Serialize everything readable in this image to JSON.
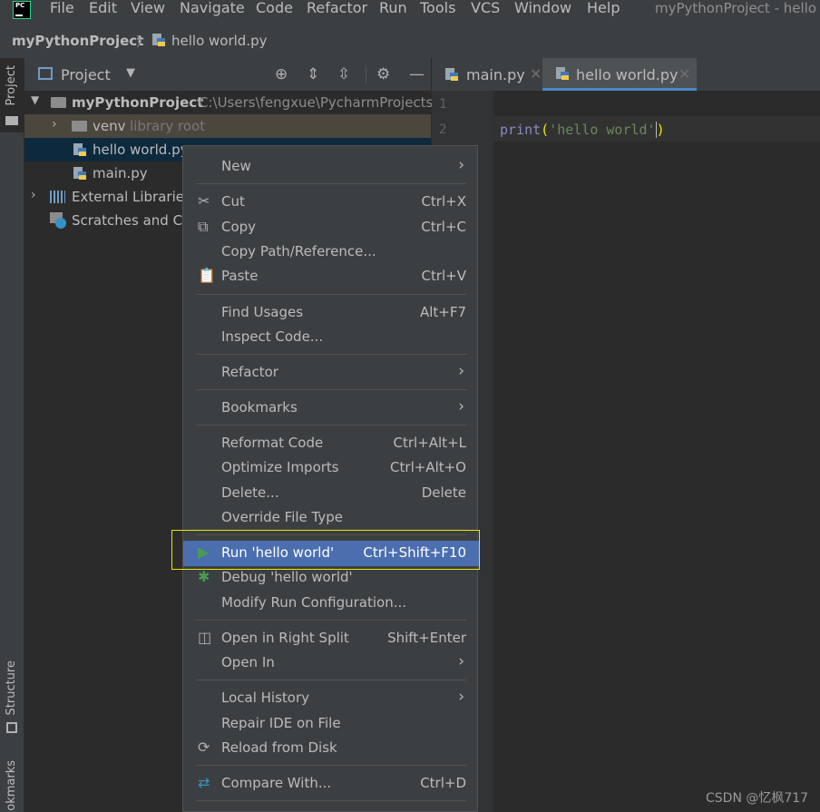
{
  "menubar": {
    "items": [
      "File",
      "Edit",
      "View",
      "Navigate",
      "Code",
      "Refactor",
      "Run",
      "Tools",
      "VCS",
      "Window",
      "Help"
    ],
    "window_title": "myPythonProject - hello w"
  },
  "navbar": {
    "project": "myPythonProject",
    "file": "hello world.py"
  },
  "left_stripe": {
    "project": "Project",
    "structure": "Structure",
    "bookmarks": "okmarks"
  },
  "project_panel": {
    "title": "Project",
    "tree": [
      {
        "label": "myPythonProject",
        "extra": "C:\\Users\\fengxue\\PycharmProjects\\"
      },
      {
        "label": "venv",
        "extra": "library root"
      },
      {
        "label": "hello world.py"
      },
      {
        "label": "main.py"
      },
      {
        "label": "External Libraries"
      },
      {
        "label": "Scratches and Co"
      }
    ]
  },
  "editor": {
    "tabs": [
      {
        "label": "main.py"
      },
      {
        "label": "hello world.py"
      }
    ],
    "line_numbers": [
      "1",
      "2"
    ],
    "code": {
      "fn": "print",
      "open_paren": "(",
      "string": "'hello world'",
      "close_paren": ")"
    }
  },
  "context_menu": {
    "items": [
      {
        "label": "New",
        "shortcut": "",
        "submenu": true
      },
      {
        "label": "Cut",
        "shortcut": "Ctrl+X",
        "icon": "scissors-icon"
      },
      {
        "label": "Copy",
        "shortcut": "Ctrl+C",
        "icon": "copy-icon"
      },
      {
        "label": "Copy Path/Reference...",
        "shortcut": ""
      },
      {
        "label": "Paste",
        "shortcut": "Ctrl+V",
        "icon": "clipboard-icon"
      },
      {
        "label": "Find Usages",
        "shortcut": "Alt+F7"
      },
      {
        "label": "Inspect Code...",
        "shortcut": ""
      },
      {
        "label": "Refactor",
        "shortcut": "",
        "submenu": true
      },
      {
        "label": "Bookmarks",
        "shortcut": "",
        "submenu": true
      },
      {
        "label": "Reformat Code",
        "shortcut": "Ctrl+Alt+L"
      },
      {
        "label": "Optimize Imports",
        "shortcut": "Ctrl+Alt+O"
      },
      {
        "label": "Delete...",
        "shortcut": "Delete"
      },
      {
        "label": "Override File Type",
        "shortcut": ""
      },
      {
        "label": "Run 'hello world'",
        "shortcut": "Ctrl+Shift+F10",
        "icon": "run-icon",
        "highlighted": true
      },
      {
        "label": "Debug 'hello world'",
        "shortcut": "",
        "icon": "debug-icon"
      },
      {
        "label": "Modify Run Configuration...",
        "shortcut": ""
      },
      {
        "label": "Open in Right Split",
        "shortcut": "Shift+Enter",
        "icon": "split-icon"
      },
      {
        "label": "Open In",
        "shortcut": "",
        "submenu": true
      },
      {
        "label": "Local History",
        "shortcut": "",
        "submenu": true
      },
      {
        "label": "Repair IDE on File",
        "shortcut": ""
      },
      {
        "label": "Reload from Disk",
        "shortcut": "",
        "icon": "reload-icon"
      },
      {
        "label": "Compare With...",
        "shortcut": "Ctrl+D",
        "icon": "compare-icon"
      }
    ]
  },
  "watermark": "CSDN @忆枫717",
  "colors": {
    "highlight": "#4b6eaf",
    "string": "#6a8759",
    "keyword": "#8888c6",
    "brace_match": "#e8e800"
  }
}
